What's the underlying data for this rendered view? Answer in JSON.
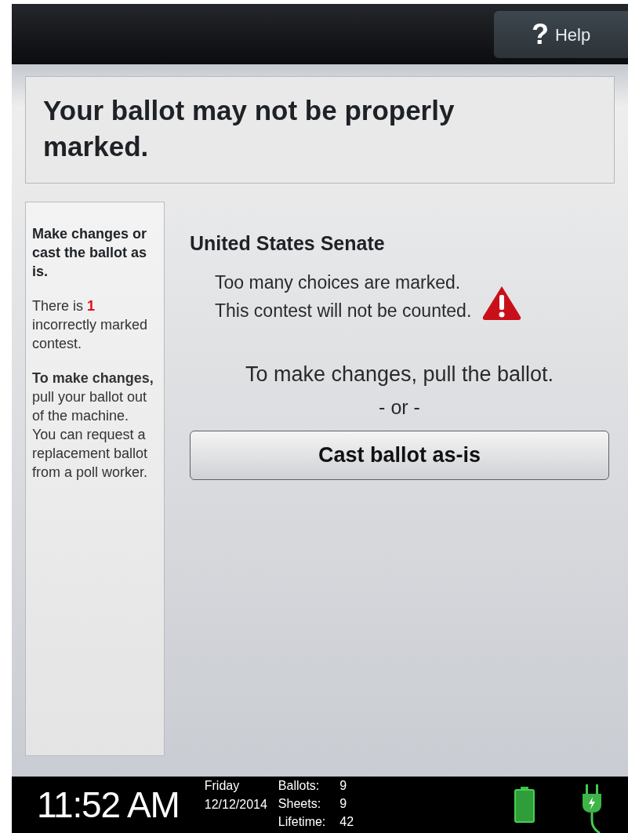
{
  "top_bar": {
    "help_button": {
      "icon_text": "?",
      "label": "Help"
    }
  },
  "header": {
    "title": "Your ballot may not be properly marked."
  },
  "sidebar": {
    "paragraphs": [
      {
        "kind": "heading",
        "text": "Make changes or cast the ballot as is."
      },
      {
        "kind": "count",
        "text": "There is **1** incorrectly marked contest."
      },
      {
        "kind": "instruction",
        "text": "**To make changes,** pull your ballot out of the machine. You can request a replacement ballot from a poll worker."
      }
    ]
  },
  "contest": {
    "title": "United States Senate",
    "messages": [
      "Too many choices are marked.",
      "This contest will not be counted."
    ]
  },
  "instructions": {
    "text": "To make changes, pull the ballot.",
    "separator": "- or -"
  },
  "cast_button": {
    "label": "Cast ballot as-is"
  },
  "status_bar": {
    "time": "11:52 AM",
    "day": "Friday",
    "date": "12/12/2014",
    "counters": [
      {
        "label": "Ballots:",
        "value": "9"
      },
      {
        "label": "Sheets:",
        "value": "9"
      },
      {
        "label": "Lifetime:",
        "value": "42"
      }
    ]
  }
}
